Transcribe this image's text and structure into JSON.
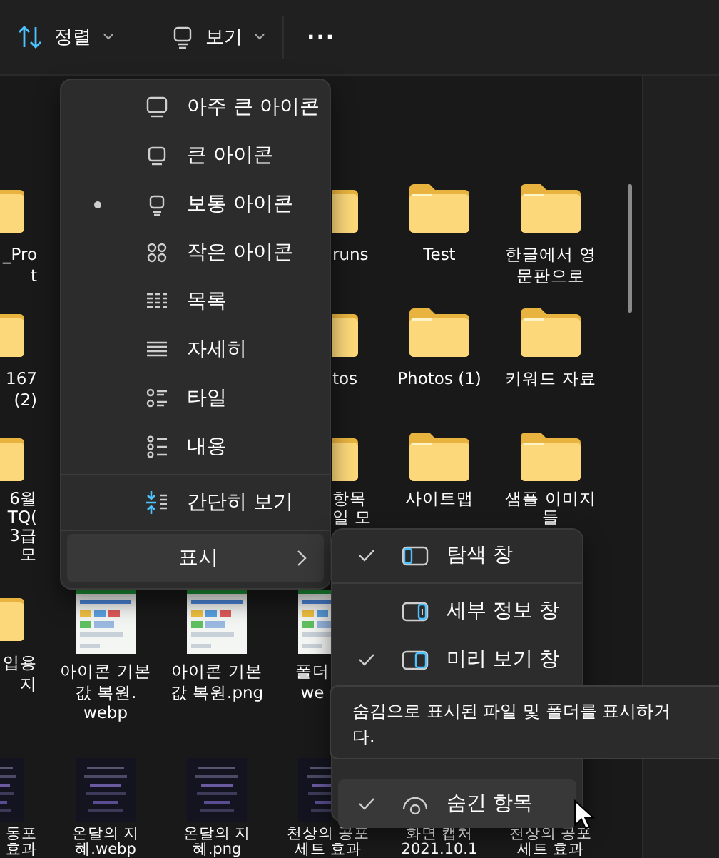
{
  "toolbar": {
    "sort": {
      "label": "정렬"
    },
    "view": {
      "label": "보기"
    },
    "more": "···"
  },
  "rows": [
    {
      "cells": [
        {
          "kind": "folder",
          "name": "_Pro\nt"
        },
        {
          "kind": "none"
        },
        {
          "kind": "none"
        },
        {
          "kind": "folder",
          "name": "runs"
        },
        {
          "kind": "folder",
          "name": "Test"
        },
        {
          "kind": "folder",
          "name": "한글에서 영\n문판으로"
        }
      ]
    },
    {
      "cells": [
        {
          "kind": "folder",
          "name": "167\n(2)"
        },
        {
          "kind": "none"
        },
        {
          "kind": "none"
        },
        {
          "kind": "folder",
          "name": "tos"
        },
        {
          "kind": "folder",
          "name": "Photos (1)"
        },
        {
          "kind": "folder",
          "name": "키워드 자료"
        }
      ]
    },
    {
      "cells": [
        {
          "kind": "folder",
          "name": "6월\nTQ(\n3급\n모"
        },
        {
          "kind": "none"
        },
        {
          "kind": "none"
        },
        {
          "kind": "folder",
          "name": "항목\n일 모"
        },
        {
          "kind": "folder",
          "name": "사이트맵"
        },
        {
          "kind": "folder",
          "name": "샘플 이미지\n들"
        }
      ]
    },
    {
      "cells": [
        {
          "kind": "folder",
          "name": "입용\n지"
        },
        {
          "name": "아이콘 기본\n값 복원.\nwebp"
        },
        {
          "name": "아이콘 기본\n값 복원.png"
        },
        {
          "name": "폴더\nwe"
        },
        {
          "kind": "none"
        },
        {
          "kind": "none"
        }
      ]
    },
    {
      "cells": [
        {
          "kind": "dark-image",
          "name": "동포\n효과"
        },
        {
          "kind": "dark-image",
          "name": "온달의 지\n혜.webp"
        },
        {
          "kind": "dark-image",
          "name": "온달의 지\n혜.png"
        },
        {
          "kind": "dark-image",
          "name": "천상의 공포\n세트 효과"
        },
        {
          "kind": "none",
          "name": "화면 캡처\n2021.10.1"
        },
        {
          "kind": "none",
          "name": "천상의 공포\n세트 효과"
        }
      ]
    }
  ],
  "view_menu": {
    "items": [
      {
        "kind": "extra-large",
        "label": "아주 큰 아이콘",
        "selected": false
      },
      {
        "kind": "large",
        "label": "큰 아이콘",
        "selected": false
      },
      {
        "kind": "medium",
        "label": "보통 아이콘",
        "selected": true
      },
      {
        "kind": "small",
        "label": "작은 아이콘",
        "selected": false
      },
      {
        "kind": "list",
        "label": "목록",
        "selected": false
      },
      {
        "kind": "details",
        "label": "자세히",
        "selected": false
      },
      {
        "kind": "tiles",
        "label": "타일",
        "selected": false
      },
      {
        "kind": "content",
        "label": "내용",
        "selected": false
      }
    ],
    "compact": {
      "label": "간단히 보기"
    },
    "show": {
      "label": "표시",
      "highlighted": true
    }
  },
  "show_menu": {
    "items": [
      {
        "kind": "navigation-pane",
        "label": "탐색 창",
        "checked": true,
        "highlighted": false
      },
      {
        "kind": "details-pane",
        "label": "세부 정보 창",
        "checked": false,
        "highlighted": false
      },
      {
        "kind": "preview-pane",
        "label": "미리 보기 창",
        "checked": true,
        "highlighted": false
      },
      {
        "kind": "hidden-items",
        "label": "숨긴 항목",
        "checked": true,
        "highlighted": true
      }
    ]
  },
  "tooltip": {
    "text": "숨김으로 표시된 파일 및 폴더를 표시하거\n다."
  }
}
